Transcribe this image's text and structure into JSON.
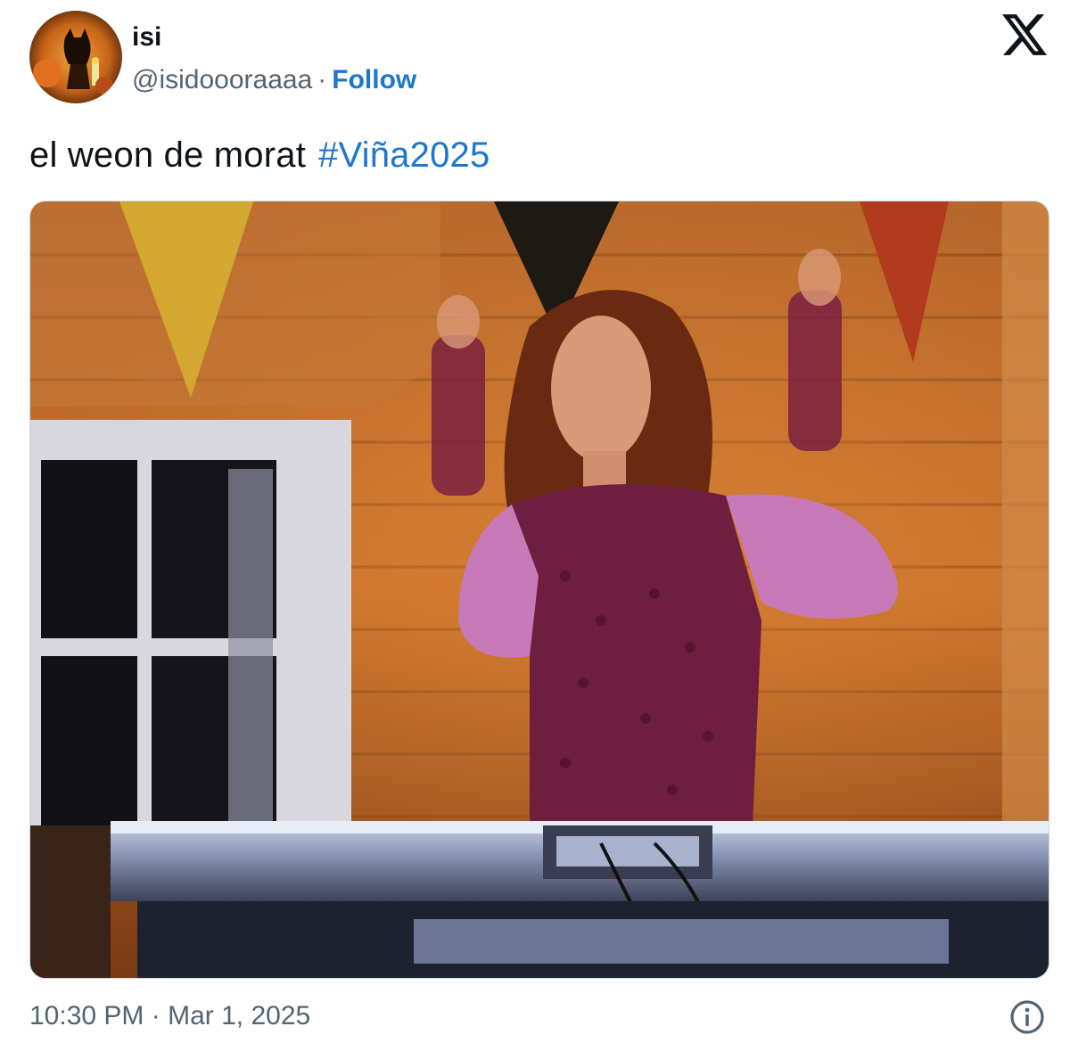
{
  "author": {
    "display_name": "isi",
    "handle": "@isidoooraaaa",
    "separator": "·",
    "follow_label": "Follow",
    "avatar_icon": "avatar-image"
  },
  "brand": {
    "logo_icon": "x-logo-icon"
  },
  "tweet": {
    "text": "el weon de morat",
    "hashtag": "#Viña2025"
  },
  "media": {
    "icon": "video-frame-image"
  },
  "footer": {
    "time": "10:30 PM",
    "separator": "·",
    "date": "Mar 1, 2025",
    "info_icon": "info-icon"
  },
  "colors": {
    "link": "#1d76d0",
    "secondary_text": "#536471",
    "primary_text": "#0f1419"
  }
}
